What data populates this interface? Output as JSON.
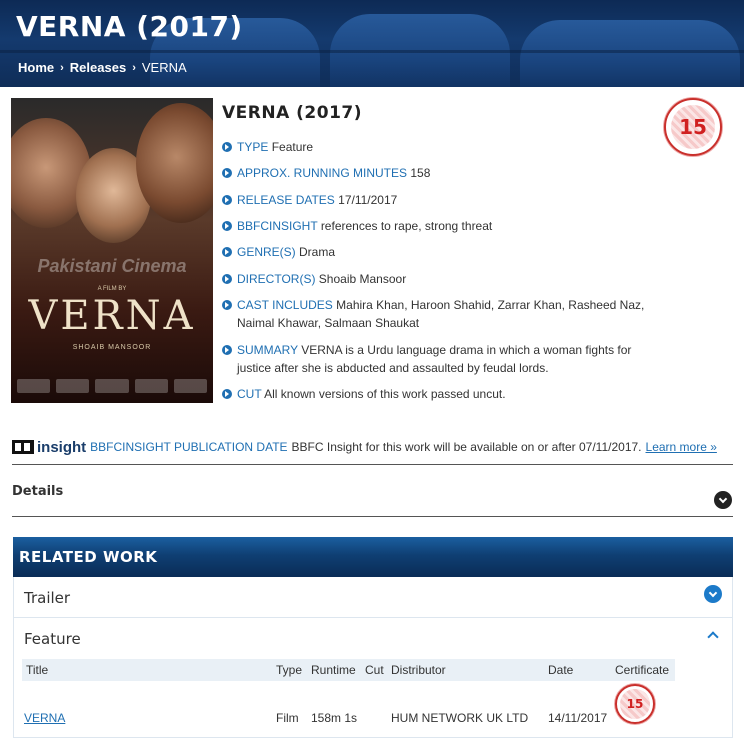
{
  "hero": {
    "title": "VERNA (2017)",
    "breadcrumb": [
      "Home",
      "Releases",
      "VERNA"
    ]
  },
  "poster": {
    "credit_small": "A FILM BY",
    "director_line": "SHOAIB MANSOOR",
    "watermark": "Pakistani Cinema",
    "title_text": "VERNA"
  },
  "film": {
    "title": "VERNA (2017)",
    "rating": "15",
    "facts": [
      {
        "key": "TYPE",
        "value": "Feature"
      },
      {
        "key": "APPROX. RUNNING MINUTES",
        "value": "158"
      },
      {
        "key": "RELEASE DATES",
        "value": "17/11/2017"
      },
      {
        "key": "BBFCINSIGHT",
        "value": "references to rape, strong threat"
      },
      {
        "key": "GENRE(S)",
        "value": "Drama"
      },
      {
        "key": "DIRECTOR(S)",
        "value": "Shoaib Mansoor"
      },
      {
        "key": "CAST INCLUDES",
        "value": "Mahira Khan, Haroon Shahid, Zarrar Khan, Rasheed Naz, Naimal Khawar, Salmaan Shaukat"
      },
      {
        "key": "SUMMARY",
        "value": "VERNA is a Urdu language drama in which a woman fights for justice after she is abducted and assaulted by feudal lords."
      },
      {
        "key": "CUT",
        "value": "All known versions of this work passed uncut."
      }
    ]
  },
  "insight": {
    "logo": "insight",
    "key": "BBFCINSIGHT PUBLICATION DATE",
    "text": "BBFC Insight for this work will be available on or after 07/11/2017.",
    "link": "Learn more »"
  },
  "details": {
    "label": "Details"
  },
  "related": {
    "heading": "RELATED WORK",
    "trailer_label": "Trailer",
    "feature_label": "Feature",
    "columns": [
      "Title",
      "Type",
      "Runtime",
      "Cut",
      "Distributor",
      "Date",
      "Certificate"
    ],
    "rows": [
      {
        "title": "VERNA",
        "type": "Film",
        "runtime": "158m 1s",
        "cut": "",
        "distributor": "HUM NETWORK UK LTD",
        "date": "14/11/2017",
        "certificate": "15"
      }
    ]
  },
  "colors": {
    "accent": "#1f6fb2",
    "header": "#0f3f73",
    "rating_red": "#d02020"
  }
}
